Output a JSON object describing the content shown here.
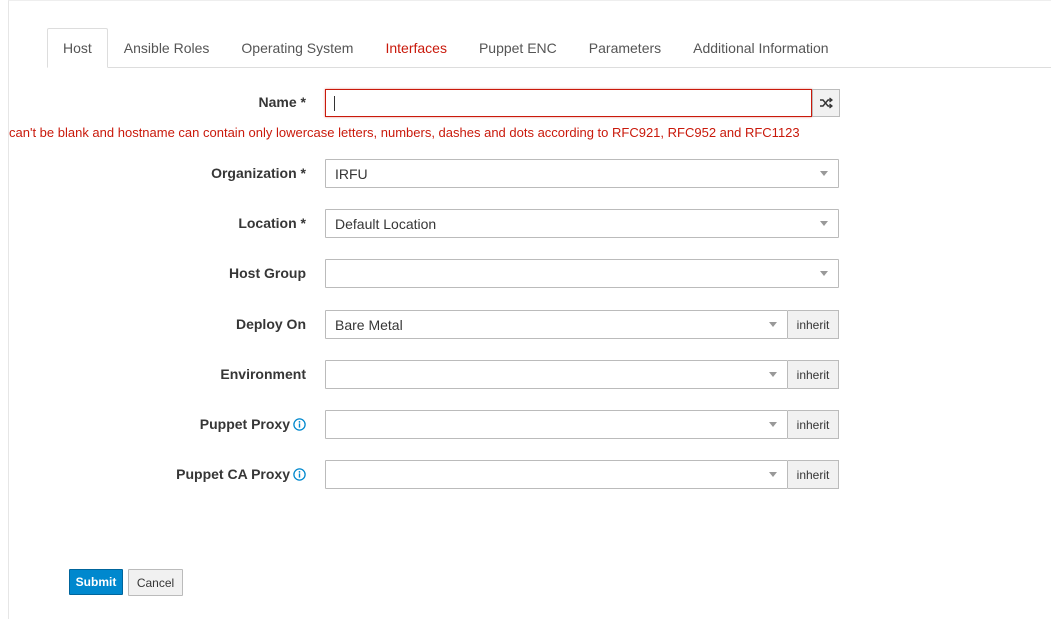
{
  "tabs": [
    {
      "label": "Host",
      "active": true,
      "error": false
    },
    {
      "label": "Ansible Roles",
      "active": false,
      "error": false
    },
    {
      "label": "Operating System",
      "active": false,
      "error": false
    },
    {
      "label": "Interfaces",
      "active": false,
      "error": true
    },
    {
      "label": "Puppet ENC",
      "active": false,
      "error": false
    },
    {
      "label": "Parameters",
      "active": false,
      "error": false
    },
    {
      "label": "Additional Information",
      "active": false,
      "error": false
    }
  ],
  "form": {
    "name": {
      "label": "Name *",
      "value": ""
    },
    "name_error": "can't be blank and hostname can contain only lowercase letters, numbers, dashes and dots according to RFC921, RFC952 and RFC1123",
    "organization": {
      "label": "Organization *",
      "value": "IRFU"
    },
    "location": {
      "label": "Location *",
      "value": "Default Location"
    },
    "host_group": {
      "label": "Host Group",
      "value": ""
    },
    "deploy_on": {
      "label": "Deploy On",
      "value": "Bare Metal",
      "inherit": "inherit"
    },
    "environment": {
      "label": "Environment",
      "value": "",
      "inherit": "inherit"
    },
    "puppet_proxy": {
      "label": "Puppet Proxy",
      "value": "",
      "inherit": "inherit"
    },
    "puppet_ca_proxy": {
      "label": "Puppet CA Proxy",
      "value": "",
      "inherit": "inherit"
    }
  },
  "actions": {
    "submit": "Submit",
    "cancel": "Cancel"
  },
  "colors": {
    "error": "#c9190b",
    "primary": "#0088ce",
    "info": "#0088ce"
  }
}
